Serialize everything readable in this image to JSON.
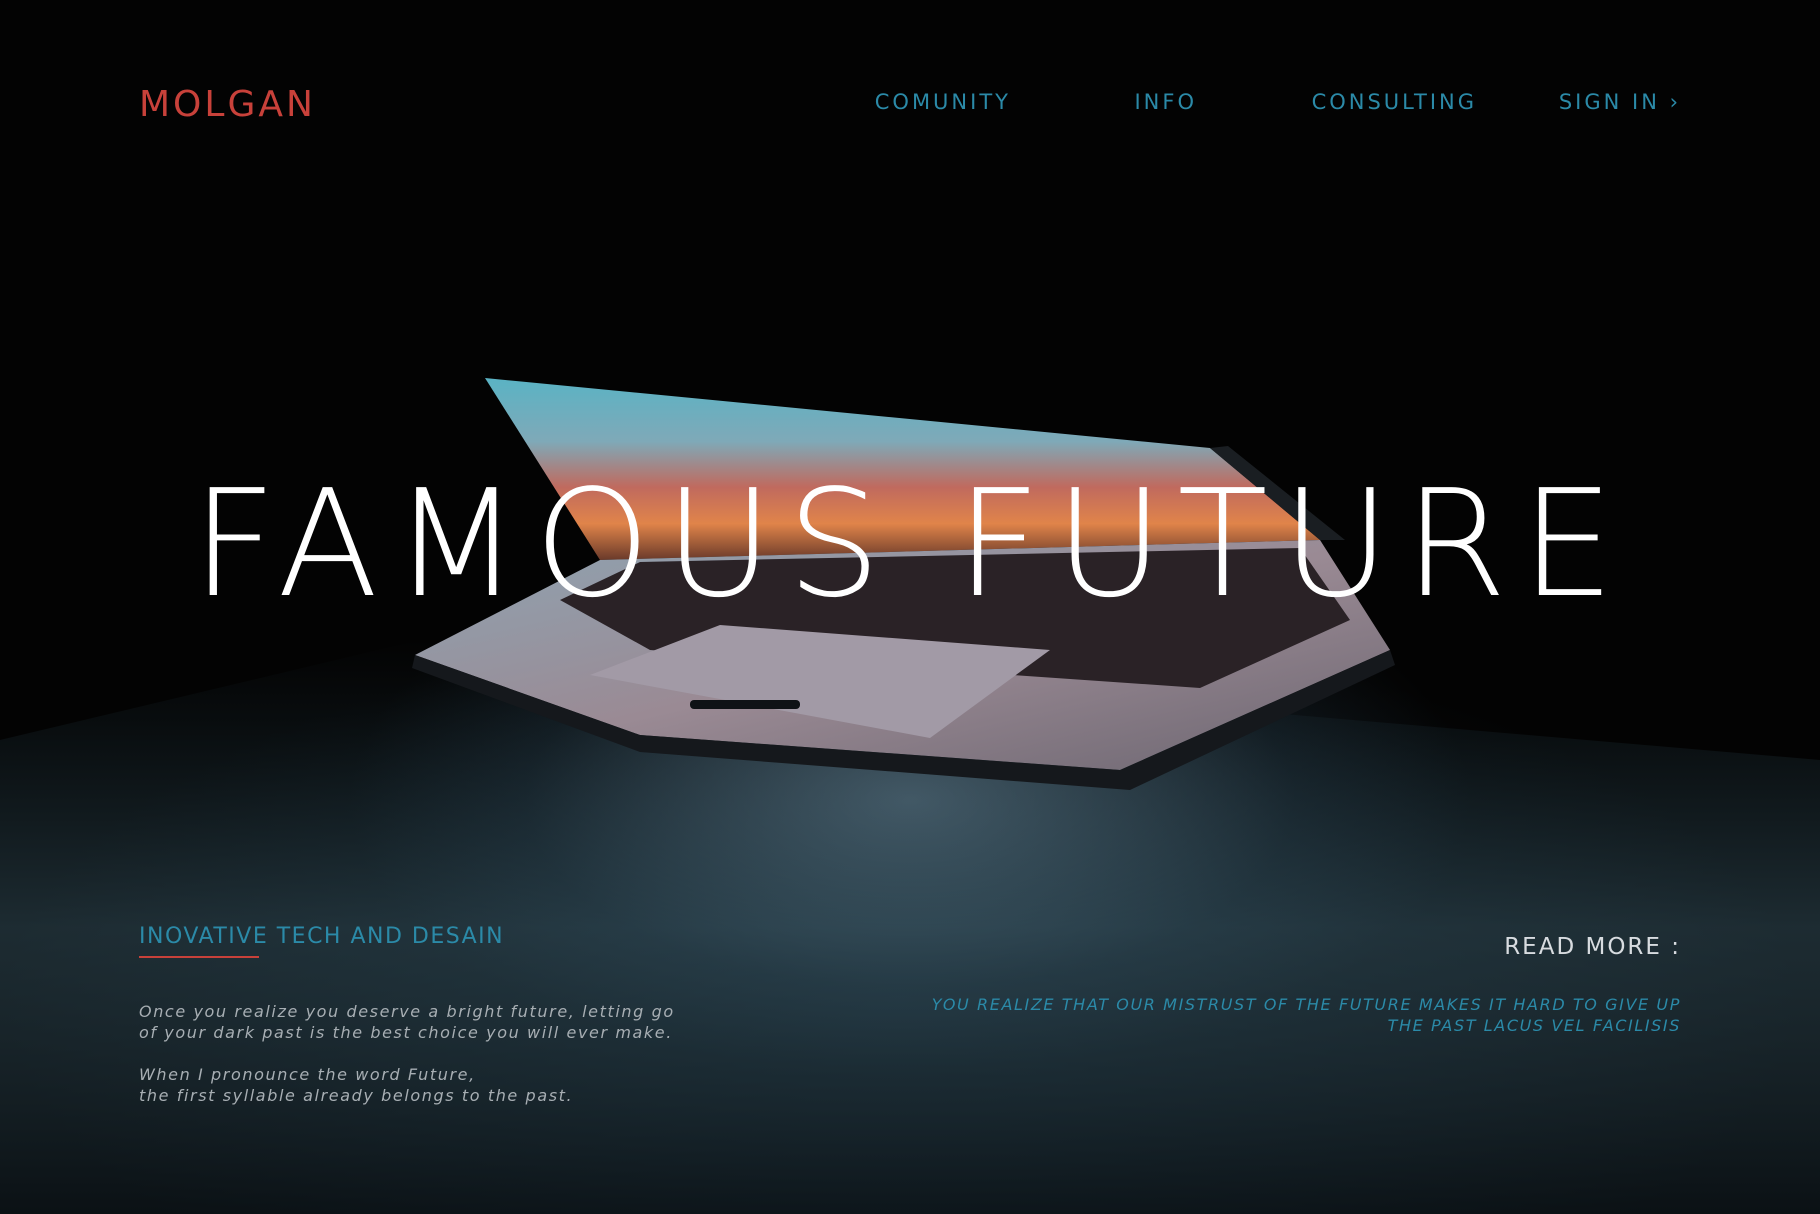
{
  "brand": {
    "logo": "MOLGAN",
    "accent_color": "#c8413a",
    "link_color": "#2b8aa8"
  },
  "nav": {
    "items": [
      {
        "label": "COMUNITY"
      },
      {
        "label": "INFO"
      },
      {
        "label": "CONSULTING"
      },
      {
        "label": "SIGN IN ›"
      }
    ]
  },
  "hero": {
    "title": "FAMOUS FUTURE",
    "image": "laptop-half-open"
  },
  "left": {
    "tagline": "INOVATIVE TECH AND DESAIN",
    "p1_line1": "Once you realize you deserve a bright future, letting go",
    "p1_line2": "of your dark past is the best choice you will ever make.",
    "p2_line1": "When I pronounce the word Future,",
    "p2_line2": "the first syllable already belongs to the past."
  },
  "right": {
    "read_more": "READ MORE :",
    "quote_line1": "YOU REALIZE THAT OUR MISTRUST OF THE FUTURE MAKES IT HARD TO GIVE UP",
    "quote_line2": "THE PAST LACUS VEL FACILISIS"
  }
}
